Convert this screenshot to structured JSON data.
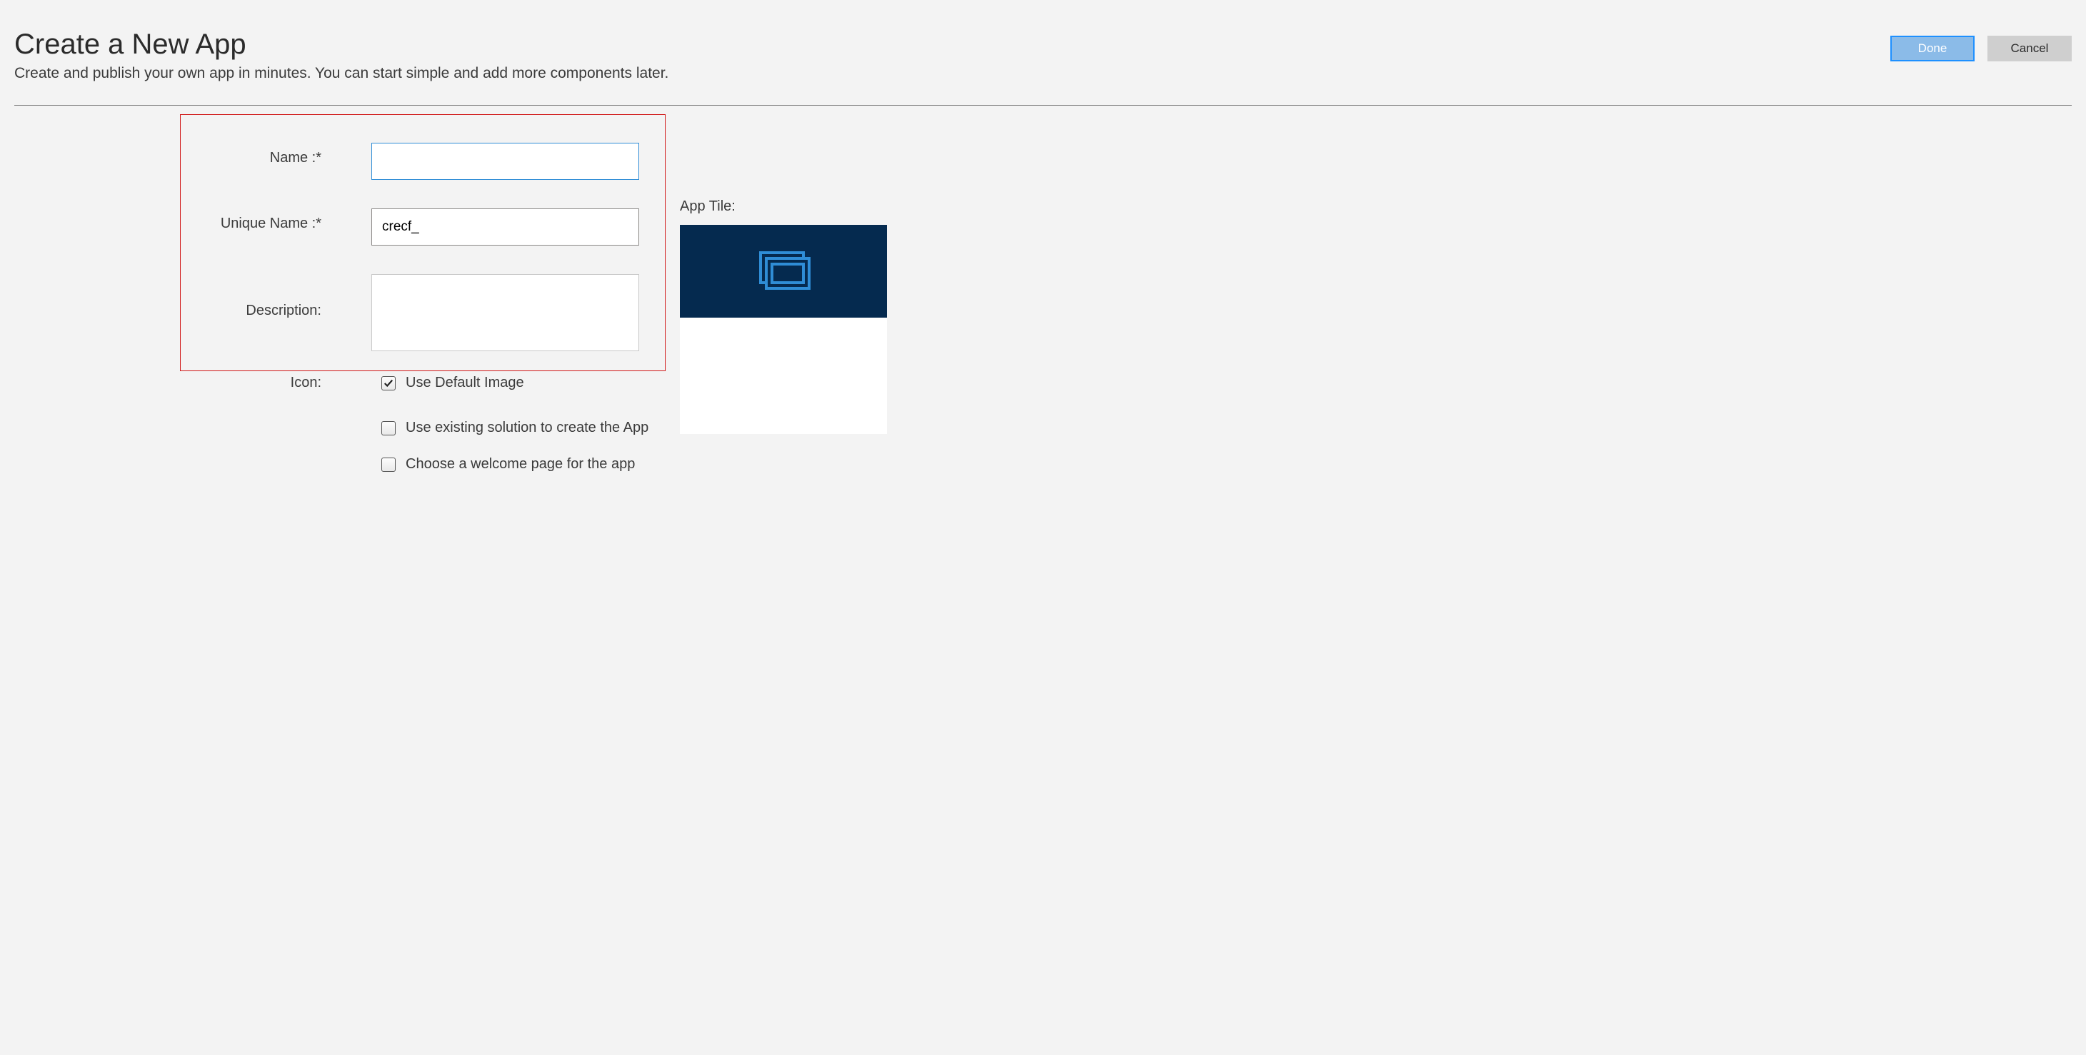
{
  "header": {
    "title": "Create a New App",
    "subtitle": "Create and publish your own app in minutes. You can start simple and add more components later.",
    "done_label": "Done",
    "cancel_label": "Cancel"
  },
  "form": {
    "name_label": "Name :*",
    "name_value": "",
    "unique_name_label": "Unique Name :*",
    "unique_name_value": "crecf_",
    "description_label": "Description:",
    "description_value": "",
    "icon_label": "Icon:",
    "use_default_image_label": "Use Default Image",
    "use_default_image_checked": true,
    "use_existing_solution_label": "Use existing solution to create the App",
    "use_existing_solution_checked": false,
    "choose_welcome_label": "Choose a welcome page for the app",
    "choose_welcome_checked": false
  },
  "tile": {
    "label": "App Tile:"
  },
  "colors": {
    "tile_header_bg": "#052a4f",
    "tile_icon": "#2f8dd6",
    "highlight_border": "#d01515",
    "primary_btn_bg": "#8bbbe8",
    "primary_btn_border": "#1e90ff"
  }
}
